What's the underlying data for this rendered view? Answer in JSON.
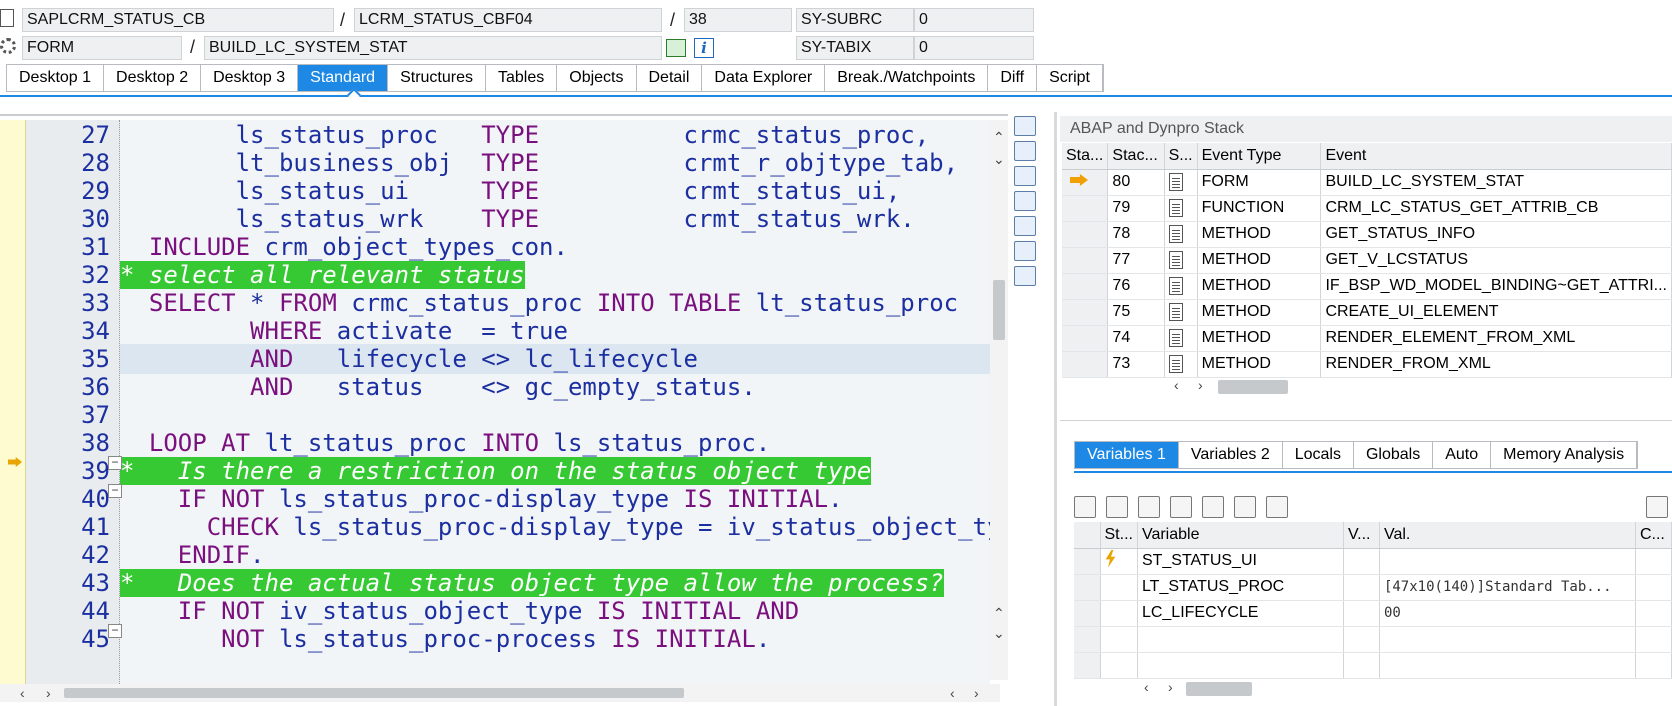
{
  "status": {
    "program": "SAPLCRM_STATUS_CB",
    "include": "LCRM_STATUS_CBF04",
    "line": "38",
    "subrc_label": "SY-SUBRC",
    "subrc_value": "0",
    "event_type": "FORM",
    "event": "BUILD_LC_SYSTEM_STAT",
    "tabix_label": "SY-TABIX",
    "tabix_value": "0",
    "sep": "/"
  },
  "tabs": [
    "Desktop 1",
    "Desktop 2",
    "Desktop 3",
    "Standard",
    "Structures",
    "Tables",
    "Objects",
    "Detail",
    "Data Explorer",
    "Break./Watchpoints",
    "Diff",
    "Script"
  ],
  "active_tab": "Standard",
  "code": {
    "lines": [
      {
        "no": "27",
        "text": "        ls_status_proc   TYPE          crmc_status_proc,"
      },
      {
        "no": "28",
        "text": "        lt_business_obj  TYPE          crmt_r_objtype_tab,"
      },
      {
        "no": "29",
        "text": "        ls_status_ui     TYPE          crmt_status_ui,"
      },
      {
        "no": "30",
        "text": "        ls_status_wrk    TYPE          crmt_status_wrk."
      },
      {
        "no": "31",
        "text": "  INCLUDE crm_object_types_con."
      },
      {
        "no": "32",
        "text": "* select all relevant status"
      },
      {
        "no": "33",
        "text": "  SELECT * FROM crmc_status_proc INTO TABLE lt_status_proc"
      },
      {
        "no": "34",
        "text": "         WHERE activate  = true"
      },
      {
        "no": "35",
        "text": "         AND   lifecycle <> lc_lifecycle"
      },
      {
        "no": "36",
        "text": "         AND   status    <> gc_empty_status."
      },
      {
        "no": "37",
        "text": ""
      },
      {
        "no": "38",
        "text": "  LOOP AT lt_status_proc INTO ls_status_proc."
      },
      {
        "no": "39",
        "text": "*   Is there a restriction on the status object type"
      },
      {
        "no": "40",
        "text": "    IF NOT ls_status_proc-display_type IS INITIAL."
      },
      {
        "no": "41",
        "text": "      CHECK ls_status_proc-display_type = iv_status_object_type."
      },
      {
        "no": "42",
        "text": "    ENDIF."
      },
      {
        "no": "43",
        "text": "*   Does the actual status object type allow the process?"
      },
      {
        "no": "44",
        "text": "    IF NOT iv_status_object_type IS INITIAL AND"
      },
      {
        "no": "45",
        "text": "       NOT ls_status_proc-process IS INITIAL."
      }
    ]
  },
  "stack": {
    "title": "ABAP and Dynpro Stack",
    "headers": [
      "Sta...",
      "Stac...",
      "S...",
      "Event Type",
      "Event"
    ],
    "rows": [
      {
        "level": "80",
        "type": "FORM",
        "event": "BUILD_LC_SYSTEM_STAT",
        "current": true
      },
      {
        "level": "79",
        "type": "FUNCTION",
        "event": "CRM_LC_STATUS_GET_ATTRIB_CB"
      },
      {
        "level": "78",
        "type": "METHOD",
        "event": "GET_STATUS_INFO"
      },
      {
        "level": "77",
        "type": "METHOD",
        "event": "GET_V_LCSTATUS"
      },
      {
        "level": "76",
        "type": "METHOD",
        "event": "IF_BSP_WD_MODEL_BINDING~GET_ATTRI..."
      },
      {
        "level": "75",
        "type": "METHOD",
        "event": "CREATE_UI_ELEMENT"
      },
      {
        "level": "74",
        "type": "METHOD",
        "event": "RENDER_ELEMENT_FROM_XML"
      },
      {
        "level": "73",
        "type": "METHOD",
        "event": "RENDER_FROM_XML"
      }
    ]
  },
  "vartabs": [
    "Variables 1",
    "Variables 2",
    "Locals",
    "Globals",
    "Auto",
    "Memory Analysis"
  ],
  "active_vartab": "Variables 1",
  "vars": {
    "headers": [
      "St...",
      "Variable",
      "V...",
      "Val.",
      "C..."
    ],
    "rows": [
      {
        "name": "ST_STATUS_UI",
        "value": "",
        "flash": true
      },
      {
        "name": "LT_STATUS_PROC",
        "value": "[47x10(140)]Standard Tab..."
      },
      {
        "name": "LC_LIFECYCLE",
        "value": "00"
      },
      {
        "name": "",
        "value": ""
      },
      {
        "name": "",
        "value": ""
      }
    ]
  },
  "colors": {
    "accent": "#1e88e5",
    "comment_bg": "#36c933",
    "keyword": "#7a0f7e",
    "code_text": "#1c2fa0"
  }
}
